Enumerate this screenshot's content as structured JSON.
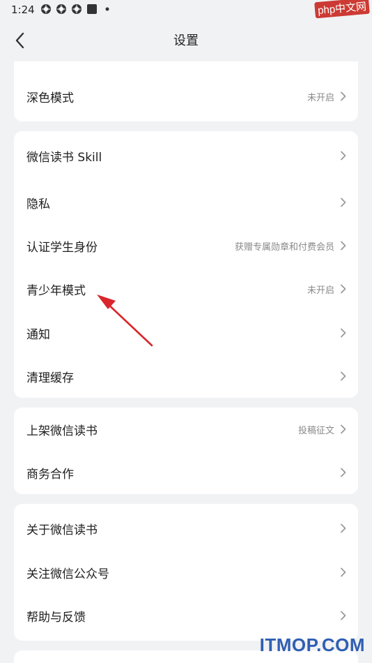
{
  "status_bar": {
    "time": "1:24",
    "icons": [
      "app-icon",
      "app-icon",
      "app-icon",
      "square-icon",
      "dot-icon"
    ]
  },
  "watermark_top": "php中文网",
  "nav": {
    "back_icon": "chevron-left-icon",
    "title": "设置"
  },
  "groups": [
    {
      "items": [
        {
          "label": "深色模式",
          "value": "未开启"
        }
      ]
    },
    {
      "items": [
        {
          "label": "微信读书 Skill",
          "value": ""
        },
        {
          "label": "隐私",
          "value": ""
        },
        {
          "label": "认证学生身份",
          "value": "获赠专属勋章和付费会员"
        },
        {
          "label": "青少年模式",
          "value": "未开启"
        },
        {
          "label": "通知",
          "value": ""
        },
        {
          "label": "清理缓存",
          "value": ""
        }
      ]
    },
    {
      "items": [
        {
          "label": "上架微信读书",
          "value": "投稿征文"
        },
        {
          "label": "商务合作",
          "value": ""
        }
      ]
    },
    {
      "items": [
        {
          "label": "关于微信读书",
          "value": ""
        },
        {
          "label": "关注微信公众号",
          "value": ""
        },
        {
          "label": "帮助与反馈",
          "value": ""
        }
      ]
    }
  ],
  "annotation": {
    "color": "#d9262c"
  },
  "watermark_bottom": "ITMOP.COM"
}
